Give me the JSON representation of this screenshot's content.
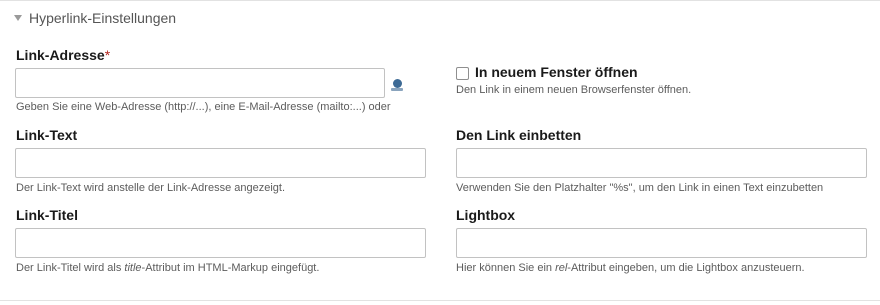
{
  "section": {
    "title": "Hyperlink-Einstellungen"
  },
  "link_address": {
    "label": "Link-Adresse",
    "required_mark": "*",
    "value": "",
    "help": "Geben Sie eine Web-Adresse (http://...), eine E-Mail-Adresse (mailto:...) oder"
  },
  "new_window": {
    "label": "In neuem Fenster öffnen",
    "checked": false,
    "help": "Den Link in einem neuen Browserfenster öffnen."
  },
  "link_text": {
    "label": "Link-Text",
    "value": "",
    "help": "Der Link-Text wird anstelle der Link-Adresse angezeigt."
  },
  "embed": {
    "label": "Den Link einbetten",
    "value": "",
    "help": "Verwenden Sie den Platzhalter \"%s\", um den Link in einen Text einzubetten"
  },
  "link_title": {
    "label": "Link-Titel",
    "value": "",
    "help_before": "Der Link-Titel wird als ",
    "help_em": "title",
    "help_after": "-Attribut im HTML-Markup eingefügt."
  },
  "lightbox": {
    "label": "Lightbox",
    "value": "",
    "help_before": "Hier können Sie ein ",
    "help_em": "rel",
    "help_after": "-Attribut eingeben, um die Lightbox anzusteuern."
  },
  "icons": {
    "legend_toggle": "triangle-down-icon",
    "picker": "page-picker-icon"
  }
}
